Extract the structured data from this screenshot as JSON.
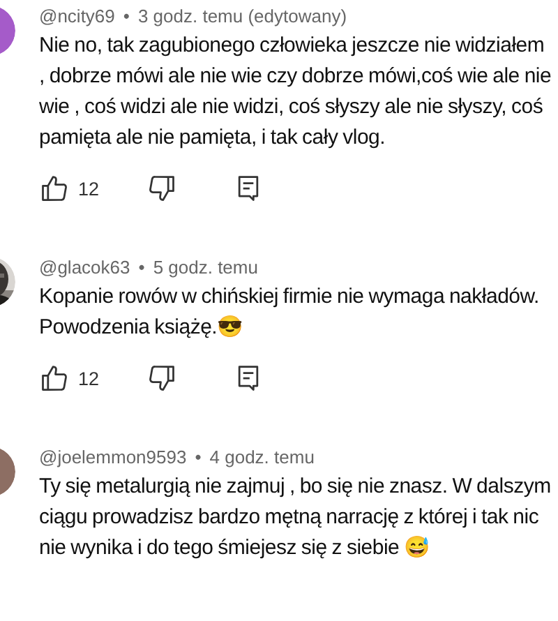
{
  "comments": [
    {
      "avatar": {
        "kind": "letter",
        "color": "#a55bc9"
      },
      "author": "@ncity69",
      "separator": "•",
      "time": "3 godz. temu (edytowany)",
      "text": "Nie no, tak zagubionego człowieka jeszcze nie widziałem ,  dobrze mówi ale nie wie czy dobrze mówi,coś wie ale nie wie , coś widzi ale nie widzi, coś słyszy ale nie słyszy, coś pamięta ale nie pamięta, i tak cały vlog.",
      "likes": "12"
    },
    {
      "author": "@glacok63",
      "separator": "•",
      "time": "5 godz. temu",
      "text": "Kopanie rowów w chińskiej firmie nie wymaga nakładów. Powodzenia książę.😎",
      "likes": "12"
    },
    {
      "avatar": {
        "kind": "letter",
        "color": "#8d6e63"
      },
      "author": "@joelemmon9593",
      "separator": "•",
      "time": "4 godz. temu",
      "text": "Ty się metalurgią nie zajmuj , bo się nie znasz. W dalszym ciągu prowadzisz bardzo mętną narrację z której i tak nic nie wynika i do tego śmiejesz się z siebie 😅"
    }
  ]
}
